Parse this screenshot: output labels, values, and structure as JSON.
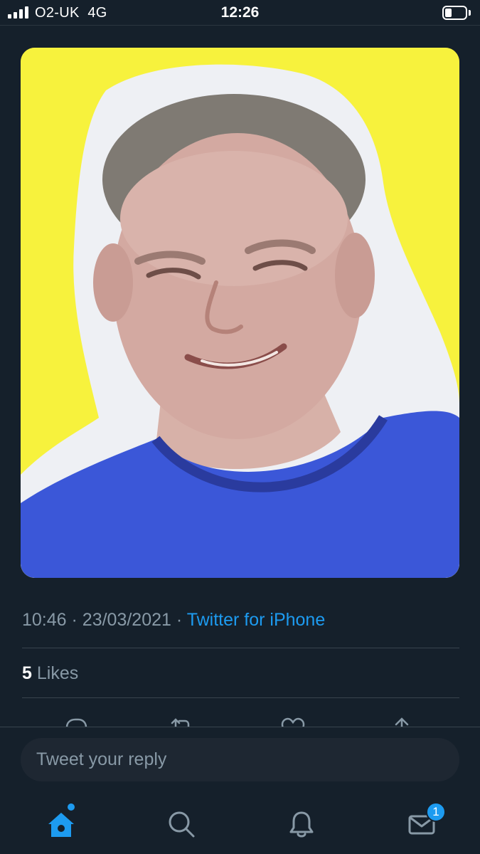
{
  "status_bar": {
    "carrier": "O2-UK",
    "network": "4G",
    "time": "12:26",
    "signal_bars": 4,
    "battery_level": 0.35
  },
  "tweet": {
    "photo_alt": "",
    "time": "10:46",
    "separator": "·",
    "date": "23/03/2021",
    "source": "Twitter for iPhone",
    "likes_count": "5",
    "likes_label": "Likes"
  },
  "actions": {
    "icons": [
      "reply-icon",
      "retweet-icon",
      "like-icon",
      "share-icon"
    ]
  },
  "composer": {
    "placeholder": "Tweet your reply",
    "value": ""
  },
  "tab_bar": {
    "tabs": [
      {
        "name": "home",
        "icon": "home-icon",
        "active": true
      },
      {
        "name": "search",
        "icon": "search-icon",
        "active": false
      },
      {
        "name": "notifications",
        "icon": "bell-icon",
        "active": false
      },
      {
        "name": "messages",
        "icon": "mail-icon",
        "active": false
      }
    ],
    "messages_badge": "1"
  },
  "colors": {
    "background": "#15202b",
    "accent": "#1d9bf0",
    "muted_text": "#8899a6",
    "divider": "#38444d",
    "photo_background": "#f7f23d",
    "shirt": "#3b57d8"
  }
}
